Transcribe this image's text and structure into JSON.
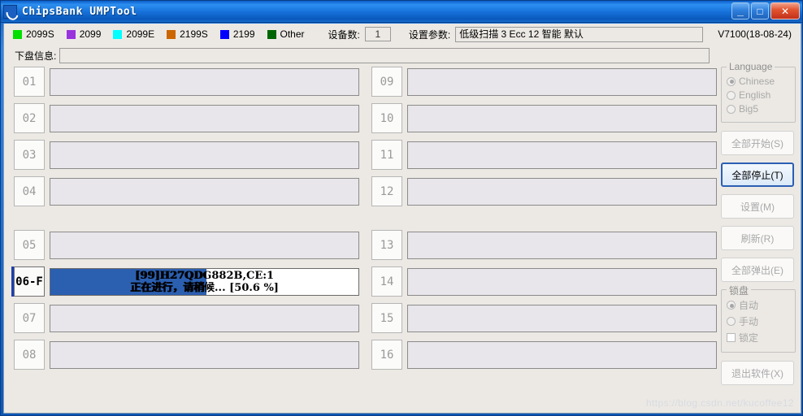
{
  "window": {
    "title": "ChipsBank UMPTool",
    "icon": "app-icon",
    "controls": {
      "minimize": "_",
      "maximize": "□",
      "close": "✕"
    }
  },
  "legend": [
    {
      "label": "2099S",
      "color": "#00e000"
    },
    {
      "label": "2099",
      "color": "#9933dd"
    },
    {
      "label": "2099E",
      "color": "#00ffff"
    },
    {
      "label": "2199S",
      "color": "#cc6600"
    },
    {
      "label": "2199",
      "color": "#0000ff"
    },
    {
      "label": "Other",
      "color": "#006600"
    }
  ],
  "toolbar": {
    "device_count_label": "设备数:",
    "device_count_value": "1",
    "param_label": "设置参数:",
    "param_value": "低级扫描 3 Ecc 12 智能 默认",
    "version": "V7100(18-08-24)"
  },
  "diskinfo": {
    "label": "下盘信息:",
    "value": ""
  },
  "slots_left": [
    {
      "id": "01",
      "text1": "",
      "text2": "",
      "progress": 0,
      "active": false,
      "gap": false
    },
    {
      "id": "02",
      "text1": "",
      "text2": "",
      "progress": 0,
      "active": false,
      "gap": false
    },
    {
      "id": "03",
      "text1": "",
      "text2": "",
      "progress": 0,
      "active": false,
      "gap": false
    },
    {
      "id": "04",
      "text1": "",
      "text2": "",
      "progress": 0,
      "active": false,
      "gap": false
    },
    {
      "id": "05",
      "text1": "",
      "text2": "",
      "progress": 0,
      "active": false,
      "gap": true
    },
    {
      "id": "06-F",
      "text1": "[99]H27QDG882B,CE:1",
      "text2": "正在进行，请稍候... [50.6 %]",
      "progress": 50.6,
      "active": true,
      "gap": false
    },
    {
      "id": "07",
      "text1": "",
      "text2": "",
      "progress": 0,
      "active": false,
      "gap": false
    },
    {
      "id": "08",
      "text1": "",
      "text2": "",
      "progress": 0,
      "active": false,
      "gap": false
    }
  ],
  "slots_right": [
    {
      "id": "09",
      "text1": "",
      "text2": "",
      "progress": 0,
      "active": false,
      "gap": false
    },
    {
      "id": "10",
      "text1": "",
      "text2": "",
      "progress": 0,
      "active": false,
      "gap": false
    },
    {
      "id": "11",
      "text1": "",
      "text2": "",
      "progress": 0,
      "active": false,
      "gap": false
    },
    {
      "id": "12",
      "text1": "",
      "text2": "",
      "progress": 0,
      "active": false,
      "gap": false
    },
    {
      "id": "13",
      "text1": "",
      "text2": "",
      "progress": 0,
      "active": false,
      "gap": true
    },
    {
      "id": "14",
      "text1": "",
      "text2": "",
      "progress": 0,
      "active": false,
      "gap": false
    },
    {
      "id": "15",
      "text1": "",
      "text2": "",
      "progress": 0,
      "active": false,
      "gap": false
    },
    {
      "id": "16",
      "text1": "",
      "text2": "",
      "progress": 0,
      "active": false,
      "gap": false
    }
  ],
  "sidebar": {
    "language": {
      "title": "Language",
      "options": [
        {
          "label": "Chinese",
          "selected": true
        },
        {
          "label": "English",
          "selected": false
        },
        {
          "label": "Big5",
          "selected": false
        }
      ]
    },
    "buttons": [
      {
        "label": "全部开始(S)",
        "enabled": false
      },
      {
        "label": "全部停止(T)",
        "enabled": true
      },
      {
        "label": "设置(M)",
        "enabled": false
      },
      {
        "label": "刷新(R)",
        "enabled": false
      },
      {
        "label": "全部弹出(E)",
        "enabled": false
      }
    ],
    "lockdisk": {
      "title": "锁盘",
      "options": [
        {
          "label": "自动",
          "selected": true
        },
        {
          "label": "手动",
          "selected": false
        }
      ],
      "checkbox": {
        "label": "锁定",
        "checked": false
      }
    },
    "exit_button": {
      "label": "退出软件(X)",
      "enabled": false
    }
  },
  "watermark": "https://blog.csdn.net/kucoffee12"
}
